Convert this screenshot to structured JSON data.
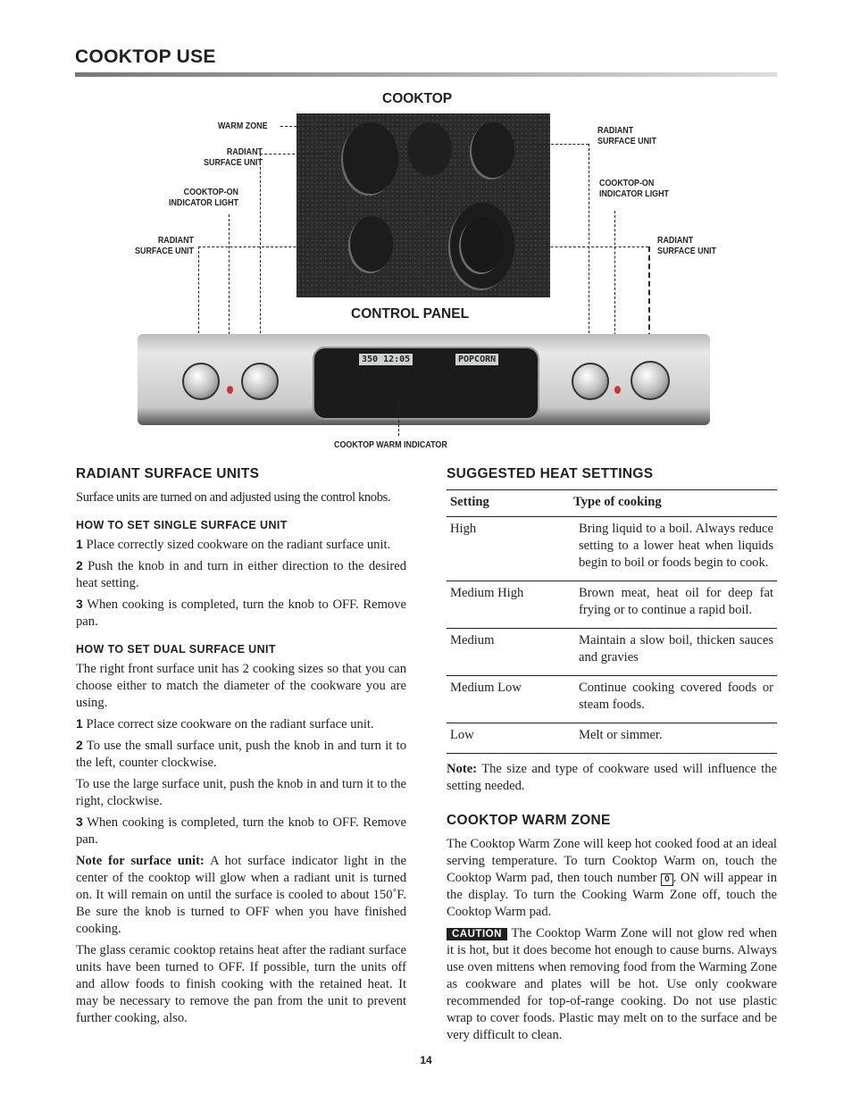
{
  "header": {
    "title": "COOKTOP USE"
  },
  "diagram": {
    "cooktop_title": "COOKTOP",
    "control_panel_title": "CONTROL PANEL",
    "labels": {
      "warm_zone": "WARM ZONE",
      "radiant_left_top": [
        "RADIANT",
        "SURFACE UNIT"
      ],
      "indicator_left": [
        "COOKTOP-ON",
        "INDICATOR LIGHT"
      ],
      "radiant_left_bottom": [
        "RADIANT",
        "SURFACE UNIT"
      ],
      "radiant_right_top": [
        "RADIANT",
        "SURFACE UNIT"
      ],
      "indicator_right": [
        "COOKTOP-ON",
        "INDICATOR LIGHT"
      ],
      "radiant_right_bottom": [
        "RADIANT",
        "SURFACE UNIT"
      ],
      "warm_indicator": "COOKTOP WARM INDICATOR"
    },
    "display_left": "350  12:05",
    "display_right": "POPCORN"
  },
  "left": {
    "title": "RADIANT SURFACE UNITS",
    "intro": "Surface units are turned on and adjusted using the control knobs.",
    "single": {
      "title": "HOW TO SET SINGLE SURFACE UNIT",
      "steps": [
        {
          "n": "1",
          "text": "Place correctly sized cookware on the radiant surface unit."
        },
        {
          "n": "2",
          "text": "Push the knob in and turn in either direction to the desired heat setting."
        },
        {
          "n": "3",
          "text": "When cooking is completed, turn the knob to OFF. Remove pan."
        }
      ]
    },
    "dual": {
      "title": "HOW TO SET DUAL SURFACE UNIT",
      "intro": "The right front surface unit has 2 cooking sizes so that you can choose either to match the diameter of the cookware you are using.",
      "step1": {
        "n": "1",
        "text": "Place correct size cookware on the radiant surface unit."
      },
      "step2": {
        "n": "2",
        "text": "To use the small surface unit, push the knob in and turn it to the left, counter clockwise."
      },
      "large": "To use the large surface unit, push the knob in and turn it to the right, clockwise.",
      "step3": {
        "n": "3",
        "text": "When cooking is completed, turn the knob to OFF. Remove pan."
      }
    },
    "note_label": "Note for surface unit:",
    "note_text": "A hot surface indicator light in the center of the cooktop will glow when a radiant unit is turned on. It will remain on until the surface is cooled to about 150˚F. Be sure the knob is turned to OFF when you have finished cooking.",
    "final": "The glass ceramic cooktop retains heat after the radiant surface units have been turned to OFF. If possible, turn the units off and allow foods to finish cooking with the retained heat. It may be necessary to remove the pan from the unit to prevent further cooking, also."
  },
  "right": {
    "title": "SUGGESTED HEAT SETTINGS",
    "table": {
      "headers": [
        "Setting",
        "Type of cooking"
      ],
      "rows": [
        [
          "High",
          "Bring liquid to a boil. Always reduce setting to a lower heat when liquids begin to boil or foods begin to cook."
        ],
        [
          "Medium High",
          "Brown meat, heat oil for deep fat frying or to continue a rapid boil."
        ],
        [
          "Medium",
          "Maintain a slow boil, thicken sauces and gravies"
        ],
        [
          "Medium Low",
          "Continue cooking covered foods or steam foods."
        ],
        [
          "Low",
          "Melt or simmer."
        ]
      ]
    },
    "note_label": "Note:",
    "note_text": "The size and type of cookware used will influence the setting needed.",
    "warm": {
      "title": "COOKTOP WARM ZONE",
      "p1a": "The Cooktop Warm Zone will keep hot cooked food at an ideal serving temperature.  To turn Cooktop Warm on, touch the Cooktop Warm pad, then touch number",
      "key": "0",
      "p1b": ". ON will appear in the display.  To turn the Cooking Warm Zone off, touch the Cooktop Warm pad.",
      "caution_label": "CAUTION",
      "caution_text": "The Cooktop Warm Zone will not glow red when it is hot, but it does become hot enough to cause burns. Always use oven mittens when removing food from the Warming Zone as cookware and plates will be hot. Use only cookware recommended for top-of-range cooking. Do not use plastic wrap to cover foods. Plastic may melt on to the surface and be very difficult to clean."
    }
  },
  "footer": {
    "page_number": "14"
  }
}
